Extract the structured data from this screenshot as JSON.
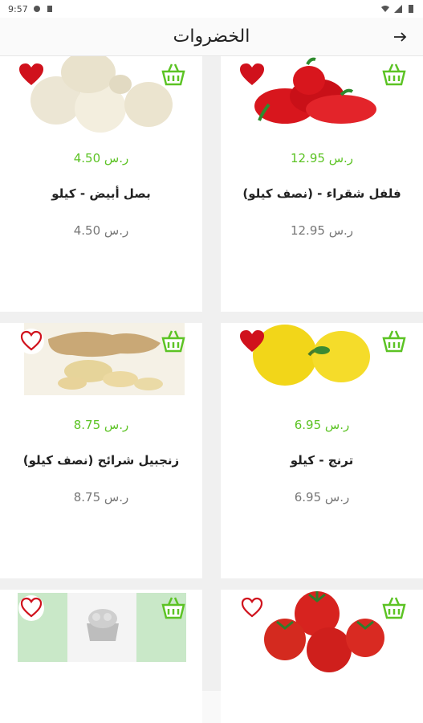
{
  "status": {
    "time": "9:57"
  },
  "header": {
    "title": "الخضروات"
  },
  "products": [
    {
      "name": "فلفل شقراء - (نصف كيلو)",
      "price": "12.95 ر.س",
      "old_price": "12.95 ر.س",
      "image": "red-pepper-image",
      "favorite": true
    },
    {
      "name": "بصل أبيض - كيلو",
      "price": "4.50 ر.س",
      "old_price": "4.50 ر.س",
      "image": "white-onion-image",
      "favorite": true
    },
    {
      "name": "ترنج - كيلو",
      "price": "6.95 ر.س",
      "old_price": "6.95 ر.س",
      "image": "citron-image",
      "favorite": true
    },
    {
      "name": "زنجبيل شرائح (نصف كيلو)",
      "price": "8.75 ر.س",
      "old_price": "8.75 ر.س",
      "image": "ginger-image",
      "favorite": false
    },
    {
      "name": "",
      "price": "",
      "old_price": "",
      "image": "tomato-image",
      "favorite": false
    },
    {
      "name": "",
      "price": "",
      "old_price": "",
      "image": "placeholder-basket-image",
      "favorite": false
    }
  ],
  "colors": {
    "accent_green": "#5cc324",
    "heart_red": "#d0111c"
  }
}
